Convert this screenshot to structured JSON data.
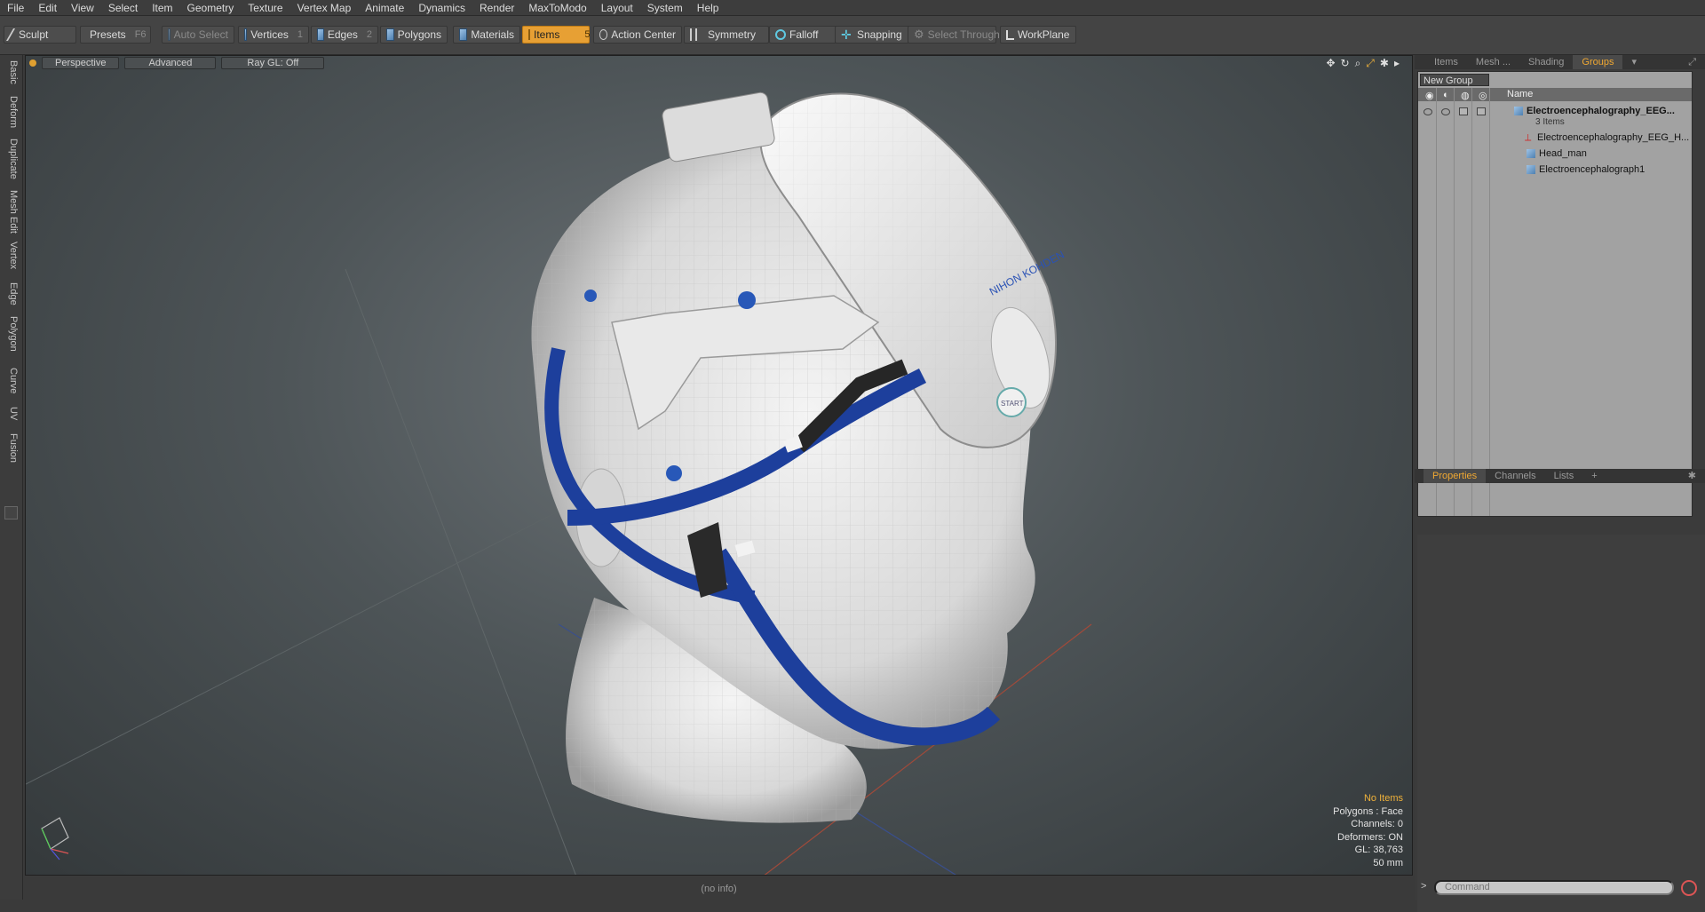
{
  "menu": [
    "File",
    "Edit",
    "View",
    "Select",
    "Item",
    "Geometry",
    "Texture",
    "Vertex Map",
    "Animate",
    "Dynamics",
    "Render",
    "MaxToModo",
    "Layout",
    "System",
    "Help"
  ],
  "toolbar": {
    "sculpt": "Sculpt",
    "presets": "Presets",
    "presets_key": "F6",
    "auto_select": "Auto Select",
    "vertices": "Vertices",
    "vertices_key": "1",
    "edges": "Edges",
    "edges_key": "2",
    "polygons": "Polygons",
    "materials": "Materials",
    "items": "Items",
    "items_key": "5",
    "action_center": "Action Center",
    "symmetry": "Symmetry",
    "falloff": "Falloff",
    "snapping": "Snapping",
    "select_through": "Select Through",
    "workplane": "WorkPlane"
  },
  "left_tabs": [
    "Basic",
    "Deform",
    "Duplicate",
    "Mesh Edit",
    "Vertex",
    "Edge",
    "Polygon",
    "Curve",
    "UV",
    "Fusion"
  ],
  "viewport": {
    "perspective": "Perspective",
    "advanced": "Advanced",
    "raygl": "Ray GL: Off",
    "brand": "NIHON KOHDEN",
    "start_label": "START",
    "info": {
      "no_items": "No Items",
      "polygons": "Polygons : Face",
      "channels": "Channels: 0",
      "deformers": "Deformers: ON",
      "gl": "GL: 38,763",
      "size": "50 mm"
    }
  },
  "right_tabs": [
    "Items",
    "Mesh ...",
    "Shading",
    "Groups"
  ],
  "groups": {
    "new_group": "New Group",
    "name_header": "Name",
    "root": "Electroencephalography_EEG...",
    "count": "3 Items",
    "children": [
      "Electroencephalography_EEG_H...",
      "Head_man",
      "Electroencephalograph1"
    ]
  },
  "props_tabs": [
    "Properties",
    "Channels",
    "Lists",
    "+"
  ],
  "status": "(no info)",
  "command_placeholder": "Command"
}
